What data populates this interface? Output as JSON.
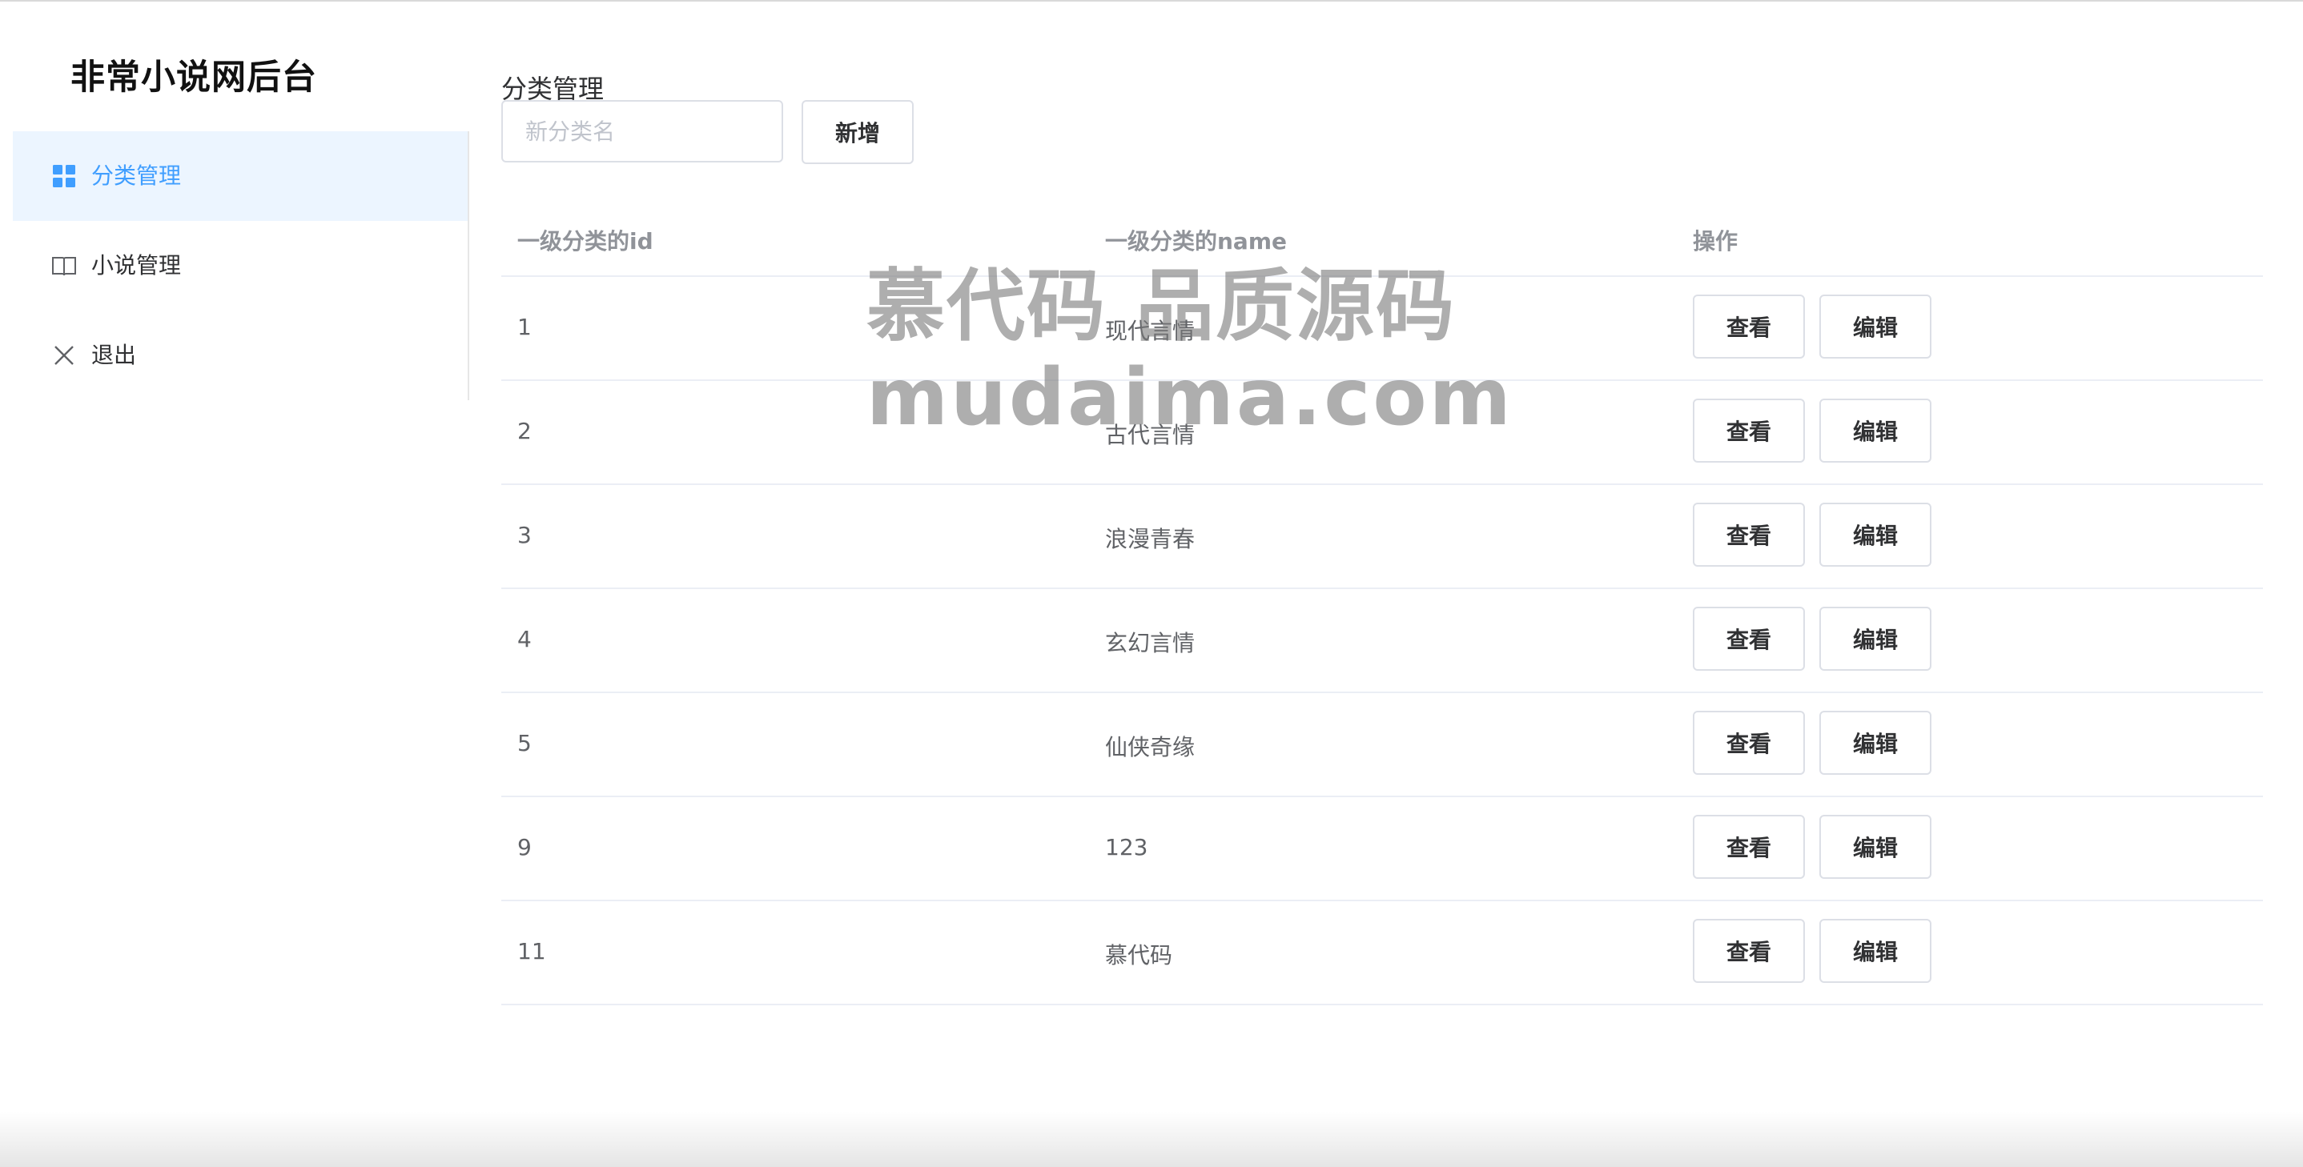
{
  "brand": {
    "title": "非常小说网后台"
  },
  "sidebar": {
    "items": [
      {
        "label": "分类管理",
        "icon": "grid-icon",
        "active": true
      },
      {
        "label": "小说管理",
        "icon": "book-icon",
        "active": false
      },
      {
        "label": "退出",
        "icon": "close-icon",
        "active": false
      }
    ]
  },
  "main": {
    "title": "分类管理",
    "new_input": {
      "placeholder": "新分类名",
      "value": ""
    },
    "add_button": "新增",
    "table": {
      "headers": [
        "一级分类的id",
        "一级分类的name",
        "操作"
      ],
      "rows": [
        {
          "id": "1",
          "name": "现代言情"
        },
        {
          "id": "2",
          "name": "古代言情"
        },
        {
          "id": "3",
          "name": "浪漫青春"
        },
        {
          "id": "4",
          "name": "玄幻言情"
        },
        {
          "id": "5",
          "name": "仙侠奇缘"
        },
        {
          "id": "9",
          "name": "123"
        },
        {
          "id": "11",
          "name": "慕代码"
        }
      ],
      "view_label": "查看",
      "edit_label": "编辑"
    }
  },
  "watermark": {
    "line1": "慕代码 品质源码",
    "line2": "mudaima.com"
  },
  "colors": {
    "accent": "#409eff",
    "active_bg": "#ecf5ff",
    "border": "#dcdfe6"
  }
}
